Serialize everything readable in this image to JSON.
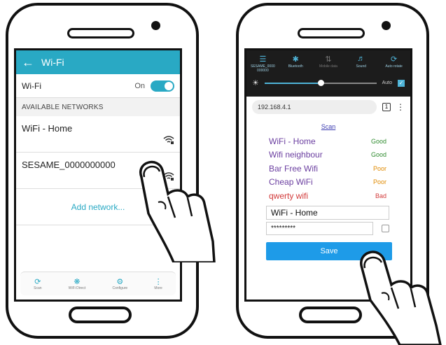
{
  "left_phone": {
    "title": "Wi-Fi",
    "wifi_label": "Wi-Fi",
    "wifi_state": "On",
    "section_header": "AVAILABLE NETWORKS",
    "networks": [
      {
        "name": "WiFi - Home",
        "signal_icon": "wifi-lock-icon"
      },
      {
        "name": "SESAME_0000000000",
        "signal_icon": "wifi-lock-icon"
      }
    ],
    "add_network": "Add network...",
    "bottom_actions": [
      "Scan",
      "WiFi Direct",
      "Configure",
      "More"
    ]
  },
  "right_phone": {
    "quick_settings": [
      {
        "label": "SESAME_0000 000000",
        "icon": "wifi-icon",
        "active": true
      },
      {
        "label": "Bluetooth",
        "icon": "bluetooth-icon",
        "active": true
      },
      {
        "label": "Mobile data",
        "icon": "mobile-data-icon",
        "active": false
      },
      {
        "label": "Sound",
        "icon": "sound-icon",
        "active": true
      },
      {
        "label": "Auto rotate",
        "icon": "rotate-icon",
        "active": true
      }
    ],
    "brightness_auto": "Auto",
    "brightness_level": 0.5,
    "url": "192.168.4.1",
    "tab_count": "1",
    "scan_link": "Scan",
    "access_points": [
      {
        "name": "WiFi - Home",
        "quality": "Good",
        "name_color": "#6b3fa0",
        "quality_color": "#2e8b2e"
      },
      {
        "name": "Wifi neighbour",
        "quality": "Good",
        "name_color": "#6b3fa0",
        "quality_color": "#2e8b2e"
      },
      {
        "name": "Bar Free Wifi",
        "quality": "Poor",
        "name_color": "#6b3fa0",
        "quality_color": "#e08a00"
      },
      {
        "name": "Cheap WiFi",
        "quality": "Poor",
        "name_color": "#6b3fa0",
        "quality_color": "#e08a00"
      },
      {
        "name": "qwerty wifi",
        "quality": "Bad",
        "name_color": "#d23a3a",
        "quality_color": "#d23a3a"
      }
    ],
    "ssid_value": "WiFi - Home",
    "password_value": "*********",
    "save_label": "Save"
  },
  "colors": {
    "accent": "#29a9c4",
    "save_button": "#1e9be8"
  }
}
